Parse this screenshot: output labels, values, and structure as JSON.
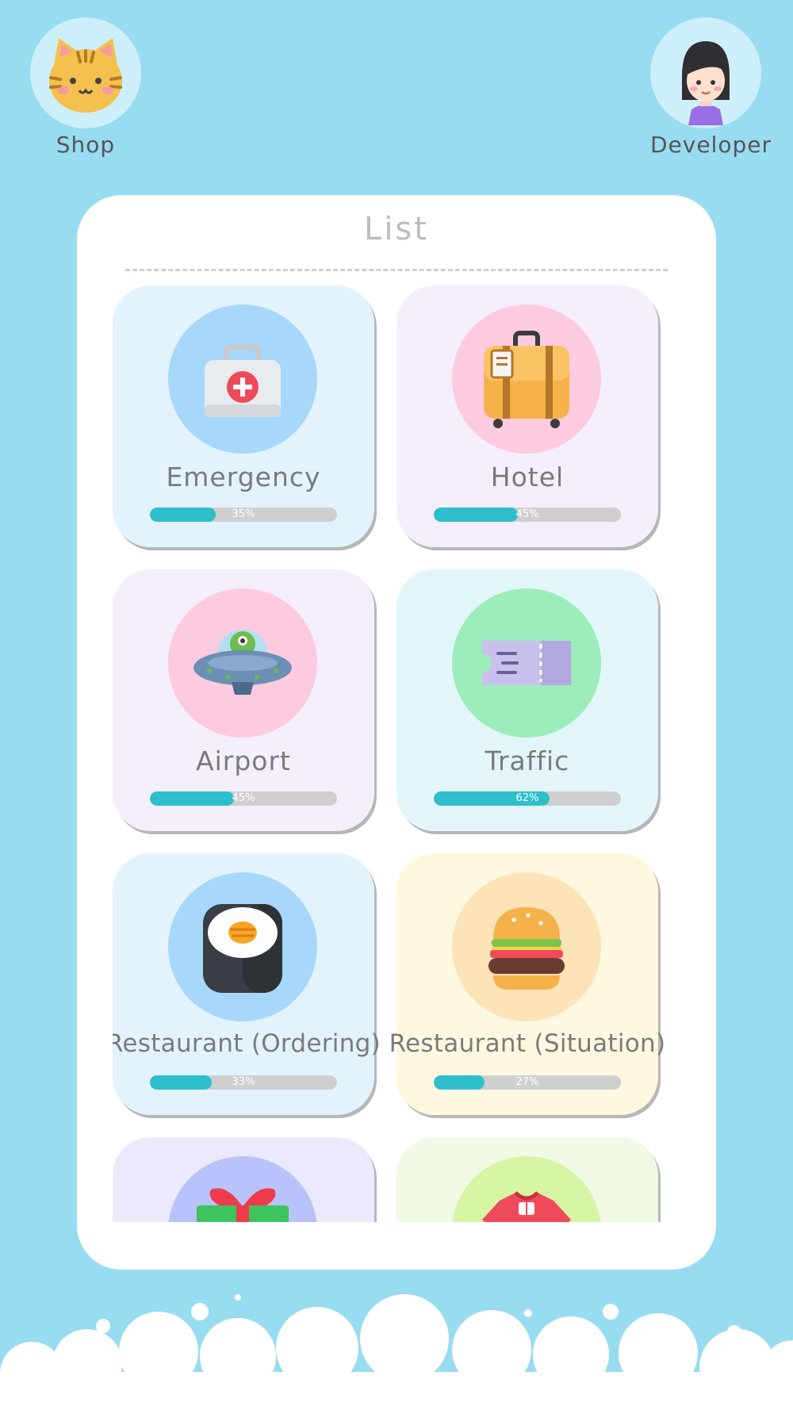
{
  "header": {
    "shop_label": "Shop",
    "developer_label": "Developer"
  },
  "panel": {
    "title": "List"
  },
  "cards": [
    {
      "title": "Emergency",
      "progress": 35,
      "progress_text": "35%",
      "bg": "#e3f3fd",
      "circle": "#a7d8fb",
      "icon": "first-aid-kit-icon"
    },
    {
      "title": "Hotel",
      "progress": 45,
      "progress_text": "45%",
      "bg": "#f5eefb",
      "circle": "#fdcbe0",
      "icon": "suitcase-icon"
    },
    {
      "title": "Airport",
      "progress": 45,
      "progress_text": "45%",
      "bg": "#f5eefb",
      "circle": "#fdcbe0",
      "icon": "ufo-icon"
    },
    {
      "title": "Traffic",
      "progress": 62,
      "progress_text": "62%",
      "bg": "#e2f6fa",
      "circle": "#9cedbb",
      "icon": "ticket-icon"
    },
    {
      "title": "Restaurant (Ordering)",
      "progress": 33,
      "progress_text": "33%",
      "bg": "#e3f3fd",
      "circle": "#a7d8fb",
      "icon": "sushi-icon"
    },
    {
      "title": "Restaurant (Situation)",
      "progress": 27,
      "progress_text": "27%",
      "bg": "#fdf8df",
      "circle": "#fde3b8",
      "icon": "burger-icon"
    },
    {
      "title": "",
      "progress": null,
      "progress_text": "",
      "bg": "#ece9fd",
      "circle": "#b8c3fb",
      "icon": "gift-icon"
    },
    {
      "title": "",
      "progress": null,
      "progress_text": "",
      "bg": "#f1fae5",
      "circle": "#d6f5a5",
      "icon": "sweater-icon"
    }
  ],
  "colors": {
    "background": "#98dcf1",
    "panel": "#ffffff",
    "progress_fill": "#2fbfcc",
    "progress_track": "#cfcfcf",
    "card_text": "#7a7a7a"
  }
}
